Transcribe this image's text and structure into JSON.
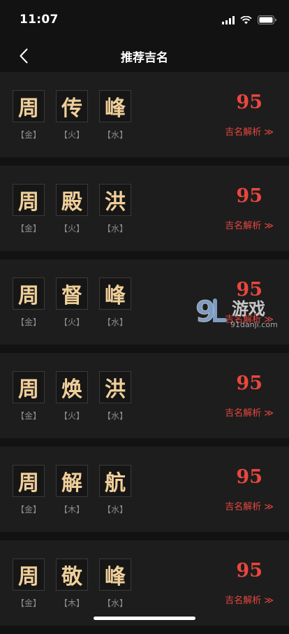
{
  "status": {
    "time": "11:07"
  },
  "header": {
    "title": "推荐吉名"
  },
  "names": [
    {
      "chars": [
        "周",
        "传",
        "峰"
      ],
      "elements": [
        "【金】",
        "【火】",
        "【水】"
      ],
      "score": "95",
      "link": "吉名解析 ≫"
    },
    {
      "chars": [
        "周",
        "殿",
        "洪"
      ],
      "elements": [
        "【金】",
        "【火】",
        "【水】"
      ],
      "score": "95",
      "link": "吉名解析 ≫"
    },
    {
      "chars": [
        "周",
        "督",
        "峰"
      ],
      "elements": [
        "【金】",
        "【火】",
        "【水】"
      ],
      "score": "95",
      "link": "吉名解析 ≫"
    },
    {
      "chars": [
        "周",
        "焕",
        "洪"
      ],
      "elements": [
        "【金】",
        "【火】",
        "【水】"
      ],
      "score": "95",
      "link": "吉名解析 ≫"
    },
    {
      "chars": [
        "周",
        "解",
        "航"
      ],
      "elements": [
        "【金】",
        "【木】",
        "【水】"
      ],
      "score": "95",
      "link": "吉名解析 ≫"
    },
    {
      "chars": [
        "周",
        "敬",
        "峰"
      ],
      "elements": [
        "【金】",
        "【木】",
        "【水】"
      ],
      "score": "95",
      "link": "吉名解析 ≫"
    }
  ],
  "watermark": {
    "logo": "9",
    "brand": "游戏",
    "url": "91danji.com"
  },
  "colors": {
    "accent": "#e8473f",
    "char": "#f0cf9a",
    "card": "#1d1d1d",
    "background": "#121212"
  }
}
